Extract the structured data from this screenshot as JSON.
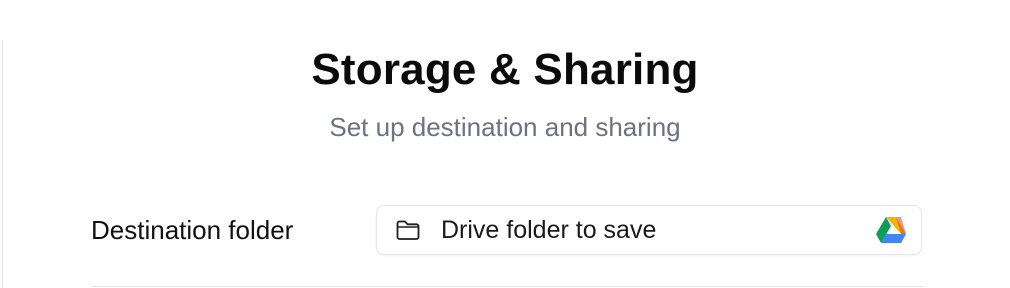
{
  "header": {
    "title": "Storage & Sharing",
    "subtitle": "Set up destination and sharing"
  },
  "destination": {
    "label": "Destination folder",
    "picker_text": "Drive folder to save",
    "leading_icon": "folder-icon",
    "trailing_icon": "google-drive-icon"
  },
  "colors": {
    "title": "#0b0b0b",
    "subtitle": "#6b7280",
    "border": "#e3e5e8",
    "drive_green": "#0f9d58",
    "drive_yellow": "#f4b400",
    "drive_blue": "#4285f4",
    "drive_red": "#db4437"
  }
}
